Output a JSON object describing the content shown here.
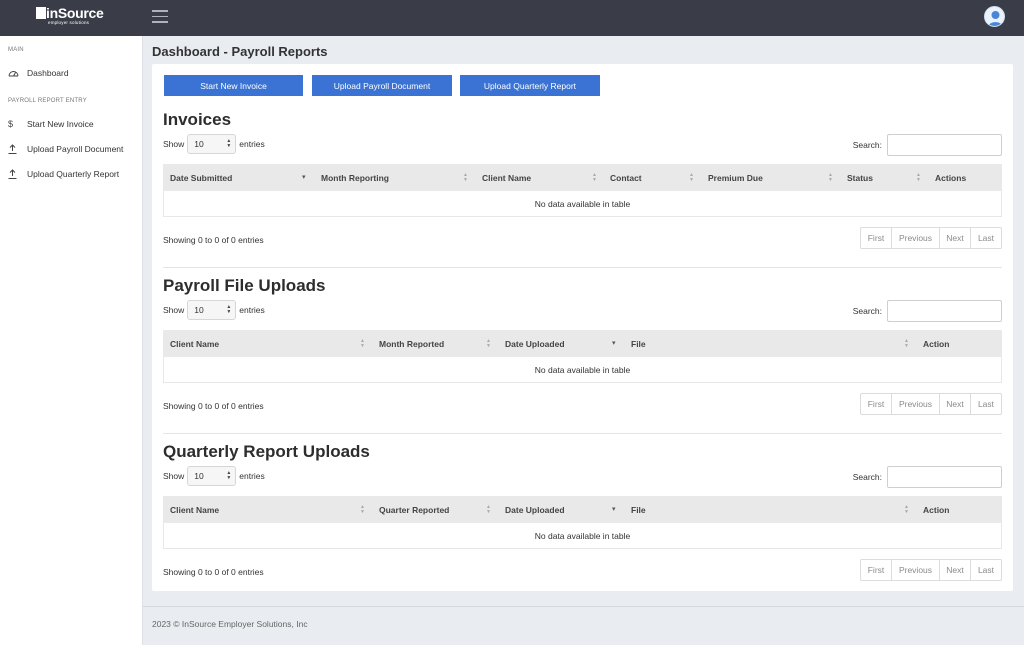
{
  "brand": {
    "logo_text": "inSource",
    "logo_sub": "employer solutions"
  },
  "sidebar": {
    "main_heading": "MAIN",
    "dashboard_label": "Dashboard",
    "payroll_heading": "PAYROLL REPORT ENTRY",
    "items": [
      {
        "label": "Start New Invoice",
        "icon": "dollar-icon"
      },
      {
        "label": "Upload Payroll Document",
        "icon": "upload-icon"
      },
      {
        "label": "Upload Quarterly Report",
        "icon": "upload-icon"
      }
    ]
  },
  "page": {
    "title": "Dashboard - Payroll Reports"
  },
  "actions": {
    "start_invoice": "Start New Invoice",
    "upload_payroll": "Upload Payroll Document",
    "upload_quarterly": "Upload Quarterly Report"
  },
  "common": {
    "show": "Show",
    "entries": "entries",
    "length_value": "10",
    "search_label": "Search:",
    "empty": "No data available in table",
    "info": "Showing 0 to 0 of 0 entries",
    "pager": {
      "first": "First",
      "previous": "Previous",
      "next": "Next",
      "last": "Last"
    }
  },
  "invoices": {
    "title": "Invoices",
    "columns": [
      "Date Submitted",
      "Month Reporting",
      "Client Name",
      "Contact",
      "Premium Due",
      "Status",
      "Actions"
    ]
  },
  "payroll_uploads": {
    "title": "Payroll File Uploads",
    "columns": [
      "Client Name",
      "Month Reported",
      "Date Uploaded",
      "File",
      "Action"
    ]
  },
  "quarterly_uploads": {
    "title": "Quarterly Report Uploads",
    "columns": [
      "Client Name",
      "Quarter Reported",
      "Date Uploaded",
      "File",
      "Action"
    ]
  },
  "footer": {
    "text": "2023 © InSource Employer Solutions, Inc"
  },
  "colors": {
    "topbar": "#3a3d48",
    "primary_button": "#3a73d3",
    "table_header": "#e9e9e9"
  }
}
